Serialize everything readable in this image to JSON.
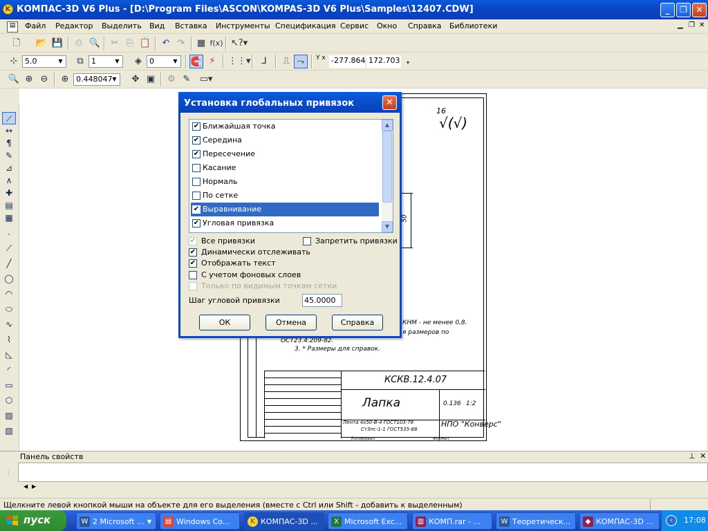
{
  "window": {
    "title": "КОМПАС-3D V6 Plus - [D:\\Program Files\\ASCON\\KOMPAS-3D V6 Plus\\Samples\\12407.CDW]"
  },
  "menu": [
    "Файл",
    "Редактор",
    "Выделить",
    "Вид",
    "Вставка",
    "Инструменты",
    "Спецификация",
    "Сервис",
    "Окно",
    "Справка",
    "Библиотеки"
  ],
  "toolbar2": {
    "style_value": "5.0",
    "layer_value": "1",
    "state_value": "0",
    "coord_x": "-277.864",
    "coord_y": "172.703",
    "coord_label": "Y x"
  },
  "toolbar3": {
    "zoom_value": "0.448047"
  },
  "dialog": {
    "title": "Установка глобальных привязок",
    "snaps": [
      {
        "label": "Ближайшая точка",
        "checked": true
      },
      {
        "label": "Середина",
        "checked": true
      },
      {
        "label": "Пересечение",
        "checked": true
      },
      {
        "label": "Касание",
        "checked": false
      },
      {
        "label": "Нормаль",
        "checked": false
      },
      {
        "label": "По сетке",
        "checked": false
      },
      {
        "label": "Выравнивание",
        "checked": true
      },
      {
        "label": "Угловая привязка",
        "checked": true
      }
    ],
    "all_snaps": "Все привязки",
    "forbid_snaps": "Запретить привязки",
    "dynamic": "Динамически отслеживать",
    "show_text": "Отображать текст",
    "background_layers": "С учетом фоновых слоев",
    "visible_grid": "Только по видимым точкам сетки",
    "angle_step_label": "Шаг угловой привязки",
    "angle_step_value": "45.0000",
    "ok": "ОК",
    "cancel": "Отмена",
    "help": "Справка"
  },
  "drawing": {
    "roughness": "16",
    "roughness_symbol": "√(√)",
    "note1": "КНМ - не менее 0,8.",
    "note2": "я размеров по",
    "note3": "ОСТ23.4.209-82.",
    "note4": "3. * Размеры для справок.",
    "code": "КСКВ.12.4.07",
    "part_name": "Лапка",
    "mass": "0.136",
    "scale": "1:2",
    "material1": "Лента 4х50-В-4 ГОСТ103-76",
    "material2": "Ст3пс-1-1 ГОСТ535-88",
    "org": "НПО \"Конверс\"",
    "format": "Формат",
    "copied": "Копировал",
    "dim": "50"
  },
  "panel": {
    "title": "Панель свойств"
  },
  "status": {
    "text": "Щелкните левой кнопкой мыши на объекте для его выделения (вместе с Ctrl или Shift - добавить к выделенным)"
  },
  "taskbar": {
    "start": "пуск",
    "tasks": [
      "2 Microsoft ...",
      "Windows Co...",
      "КОМПАС-3D ...",
      "Microsoft Exc...",
      "КОМП.rar - ...",
      "Теоретическ...",
      "КОМПАС-3D ..."
    ],
    "time": "17:08"
  }
}
